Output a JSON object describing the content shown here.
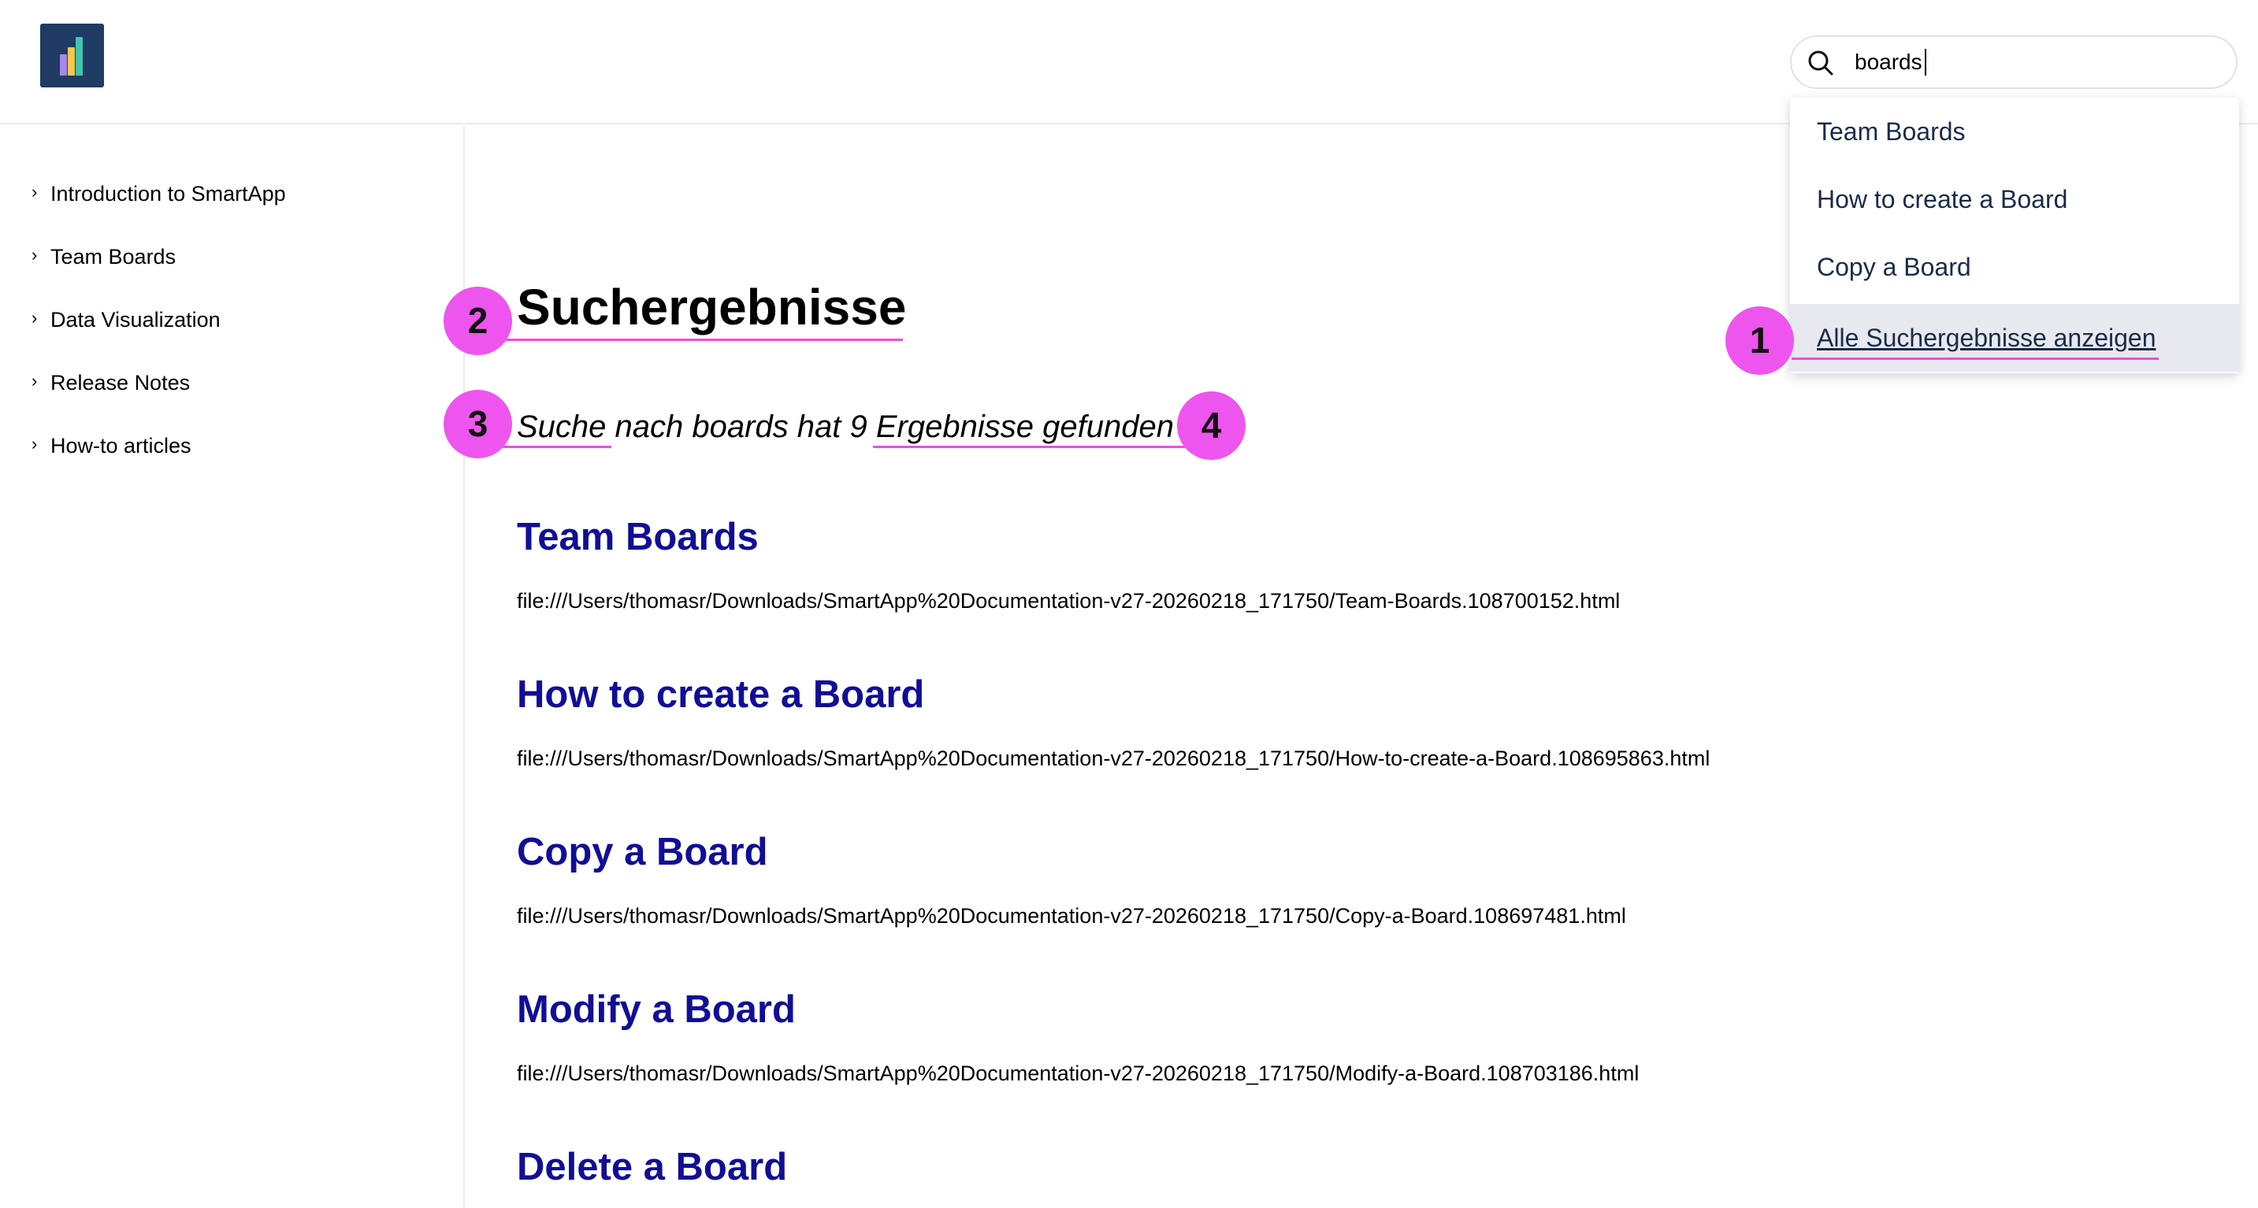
{
  "header": {
    "logo_name": "chart-logo",
    "search": {
      "value": "boards",
      "icon": "search-icon"
    }
  },
  "search_dropdown": {
    "items": [
      {
        "label": "Team Boards"
      },
      {
        "label": "How to create a Board"
      },
      {
        "label": "Copy a Board"
      },
      {
        "label": "Alle Suchergebnisse anzeigen"
      }
    ]
  },
  "sidebar": {
    "chevron": "›",
    "items": [
      {
        "label": "Introduction to SmartApp"
      },
      {
        "label": "Team Boards"
      },
      {
        "label": "Data Visualization"
      },
      {
        "label": "Release Notes"
      },
      {
        "label": "How-to articles"
      }
    ]
  },
  "main": {
    "title": "Suchergebnisse",
    "summary": "Suche nach boards hat 9 Ergebnisse gefunden",
    "results": [
      {
        "title": "Team Boards",
        "path": "file:///Users/thomasr/Downloads/SmartApp%20Documentation-v27-20260218_171750/Team-Boards.108700152.html"
      },
      {
        "title": "How to create a Board",
        "path": "file:///Users/thomasr/Downloads/SmartApp%20Documentation-v27-20260218_171750/How-to-create-a-Board.108695863.html"
      },
      {
        "title": "Copy a Board",
        "path": "file:///Users/thomasr/Downloads/SmartApp%20Documentation-v27-20260218_171750/Copy-a-Board.108697481.html"
      },
      {
        "title": "Modify a Board",
        "path": "file:///Users/thomasr/Downloads/SmartApp%20Documentation-v27-20260218_171750/Modify-a-Board.108703186.html"
      },
      {
        "title": "Delete a Board"
      }
    ]
  },
  "annotations": {
    "color": "#ee55ee",
    "markers": [
      "1",
      "2",
      "3",
      "4"
    ]
  }
}
